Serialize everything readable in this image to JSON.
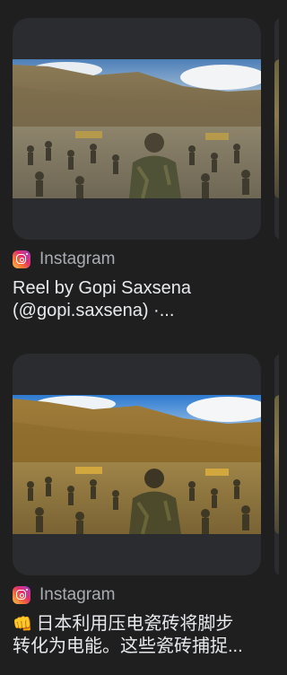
{
  "results": [
    {
      "source": "Instagram",
      "title_lines": [
        "Reel by Gopi Saxsena",
        "(@gopi.saxsena) ·..."
      ],
      "thumbnail_icon": "video-thumbnail"
    },
    {
      "source": "Instagram",
      "emoji": "👊",
      "title_lines": [
        "日本利用压电瓷砖将脚步",
        "转化为电能。这些瓷砖捕捉..."
      ],
      "thumbnail_icon": "video-thumbnail"
    }
  ],
  "colors": {
    "background": "#1f1f1f",
    "card": "#2b2c2f",
    "source_text": "#a9adb3",
    "title_text": "#e8eaed"
  }
}
